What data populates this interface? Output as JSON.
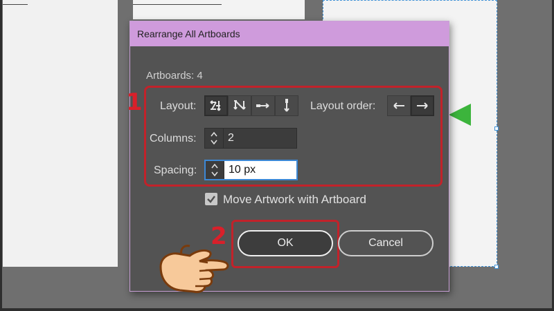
{
  "dialog": {
    "title": "Rearrange All Artboards",
    "artboards_count": "Artboards: 4",
    "layout_label": "Layout:",
    "layout_order_label": "Layout order:",
    "columns_label": "Columns:",
    "columns_value": "2",
    "spacing_label": "Spacing:",
    "spacing_value": "10 px",
    "move_artwork_label": "Move Artwork with Artboard",
    "move_artwork_checked": true,
    "ok_label": "OK",
    "cancel_label": "Cancel",
    "layout_icons": [
      "grid-by-row-icon",
      "grid-by-column-icon",
      "arrange-by-row-icon",
      "arrange-by-column-icon"
    ],
    "layout_order_icons": [
      "left-to-right-icon",
      "right-to-left-icon"
    ]
  },
  "annotations": {
    "step1": "1",
    "step2": "2",
    "highlight_color": "#c2222a"
  },
  "colors": {
    "titlebar": "#cf9bdc",
    "dialog_bg": "#535353",
    "focus": "#3c88d6"
  }
}
